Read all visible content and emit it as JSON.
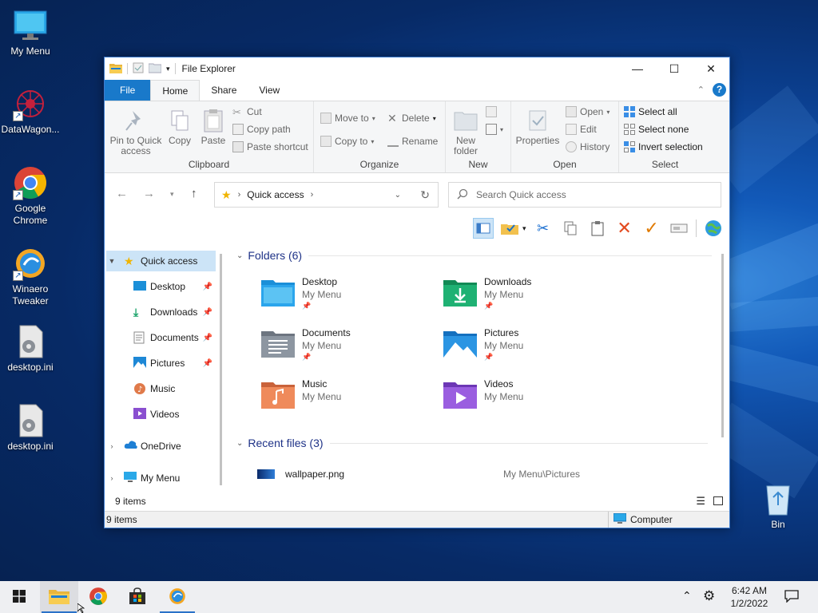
{
  "desktop": {
    "icons": [
      {
        "label": "My Menu",
        "icon": "monitor-icon"
      },
      {
        "label": "DataWagon...",
        "icon": "datawagon-icon"
      },
      {
        "label": "Google Chrome",
        "icon": "chrome-icon"
      },
      {
        "label": "Winaero Tweaker",
        "icon": "winaero-icon"
      },
      {
        "label": "desktop.ini",
        "icon": "settings-file-icon"
      },
      {
        "label": "desktop.ini",
        "icon": "settings-file-icon"
      },
      {
        "label": "Bin",
        "icon": "recycle-bin-icon"
      }
    ]
  },
  "window": {
    "title": "File Explorer",
    "controls": {
      "minimize": "—",
      "maximize": "☐",
      "close": "✕"
    },
    "tabs": [
      "File",
      "Home",
      "Share",
      "View"
    ],
    "active_tab": "Home",
    "ribbon": {
      "clipboard": {
        "label": "Clipboard",
        "pin": "Pin to Quick access",
        "copy": "Copy",
        "paste": "Paste",
        "cut": "Cut",
        "copy_path": "Copy path",
        "paste_shortcut": "Paste shortcut"
      },
      "organize": {
        "label": "Organize",
        "move_to": "Move to",
        "copy_to": "Copy to",
        "delete": "Delete",
        "rename": "Rename"
      },
      "new": {
        "label": "New",
        "new_folder": "New folder"
      },
      "open": {
        "label": "Open",
        "properties": "Properties",
        "open": "Open",
        "edit": "Edit",
        "history": "History"
      },
      "select": {
        "label": "Select",
        "select_all": "Select all",
        "select_none": "Select none",
        "invert": "Invert selection"
      }
    },
    "address": {
      "path": "Quick access"
    },
    "search": {
      "placeholder": "Search Quick access"
    },
    "nav_pane": {
      "quick_access": "Quick access",
      "items": [
        {
          "label": "Desktop",
          "pinned": true
        },
        {
          "label": "Downloads",
          "pinned": true
        },
        {
          "label": "Documents",
          "pinned": true
        },
        {
          "label": "Pictures",
          "pinned": true
        },
        {
          "label": "Music",
          "pinned": false
        },
        {
          "label": "Videos",
          "pinned": false
        }
      ],
      "onedrive": "OneDrive",
      "my_menu": "My Menu"
    },
    "content": {
      "folders_header": "Folders (6)",
      "folders": [
        {
          "name": "Desktop",
          "location": "My Menu",
          "pinned": true,
          "color": "#1b8fd8"
        },
        {
          "name": "Downloads",
          "location": "My Menu",
          "pinned": true,
          "color": "#1aa36a"
        },
        {
          "name": "Documents",
          "location": "My Menu",
          "pinned": true,
          "color": "#7d8590"
        },
        {
          "name": "Pictures",
          "location": "My Menu",
          "pinned": true,
          "color": "#1e88d6"
        },
        {
          "name": "Music",
          "location": "My Menu",
          "pinned": false,
          "color": "#e07a4a"
        },
        {
          "name": "Videos",
          "location": "My Menu",
          "pinned": false,
          "color": "#8a4fd0"
        }
      ],
      "recent_header": "Recent files (3)",
      "recent_files": [
        {
          "name": "wallpaper.png",
          "path": "My Menu\\Pictures"
        }
      ]
    },
    "status": {
      "items": "9 items",
      "bar_items": "9 items",
      "computer": "Computer"
    }
  },
  "taskbar": {
    "time": "6:42 AM",
    "date": "1/2/2022"
  }
}
